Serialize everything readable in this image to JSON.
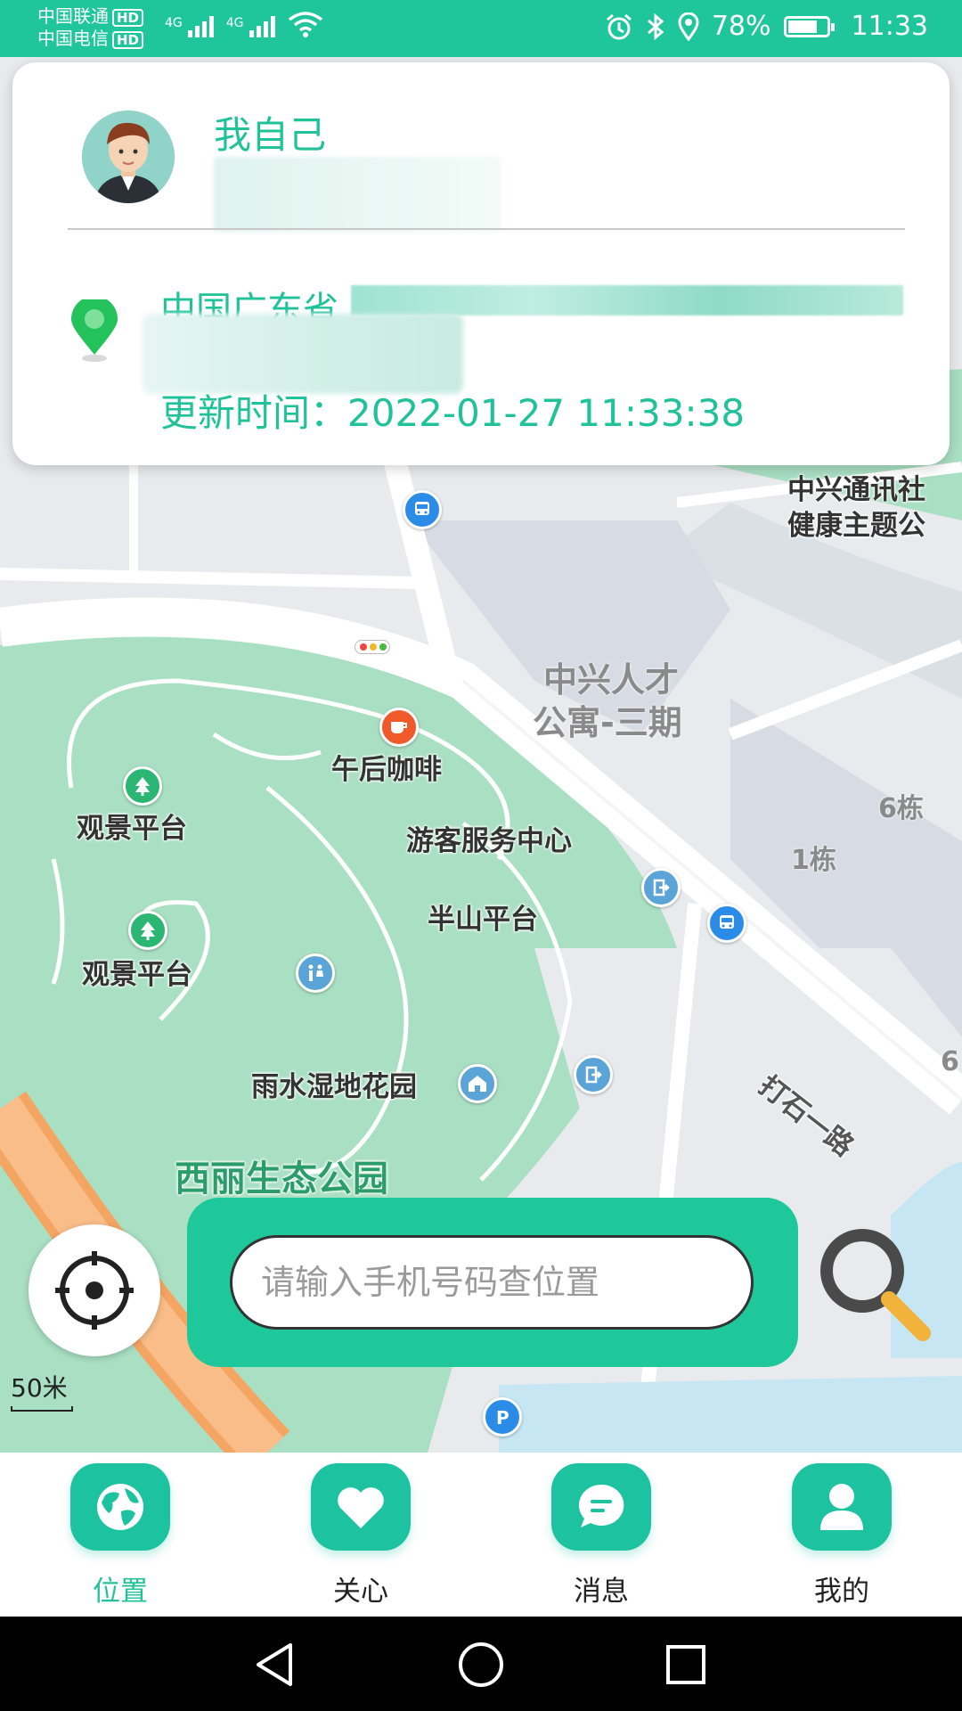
{
  "status_bar": {
    "carrier1": "中国联通",
    "carrier2": "中国电信",
    "hd_badge": "HD",
    "network_type": "4G",
    "battery": "78%",
    "battery_level": 0.78,
    "time": "11:33",
    "icons": [
      "alarm-icon",
      "bluetooth-icon",
      "location-icon",
      "wifi-icon"
    ]
  },
  "card": {
    "name": "我自己",
    "address_visible": "中国广东省",
    "update_time": "更新时间：2022-01-27 11:33:38"
  },
  "map": {
    "labels": {
      "zte_park": "中兴通讯社",
      "health_park": "健康主题公",
      "talent_apt_1": "中兴人才",
      "talent_apt_2": "公寓-三期",
      "cafe": "午后咖啡",
      "viewpoint1": "观景平台",
      "viewpoint2": "观景平台",
      "visitor_center": "游客服务中心",
      "halfway": "半山平台",
      "building6": "6栋",
      "building1": "1栋",
      "building6b": "6",
      "road": "打石一路",
      "garden": "雨水湿地花园",
      "park_name": "西丽生态公园"
    },
    "scale_label": "50米"
  },
  "search": {
    "placeholder": "请输入手机号码查位置"
  },
  "bottom_nav": {
    "items": [
      {
        "label": "位置",
        "icon": "globe-icon",
        "active": true
      },
      {
        "label": "关心",
        "icon": "heart-icon",
        "active": false
      },
      {
        "label": "消息",
        "icon": "chat-icon",
        "active": false
      },
      {
        "label": "我的",
        "icon": "user-icon",
        "active": false
      }
    ]
  },
  "colors": {
    "accent": "#1EC89A",
    "park_green": "#A8DEC0",
    "road_orange": "#F7B27A"
  }
}
